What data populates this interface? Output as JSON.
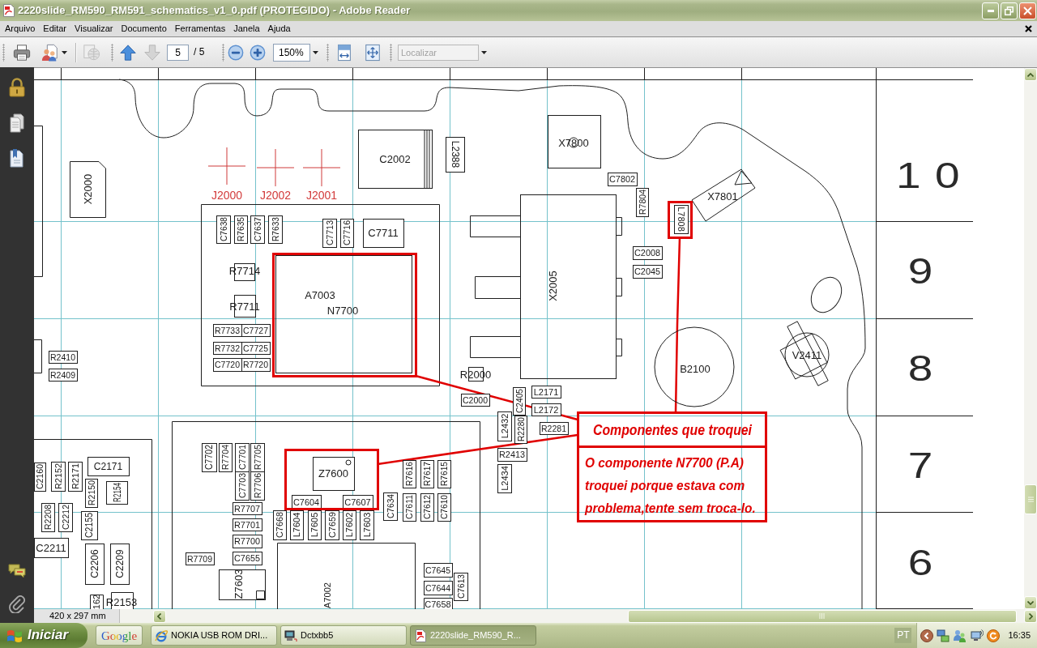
{
  "window": {
    "title": "2220slide_RM590_RM591_schematics_v1_0.pdf (PROTEGIDO) - Adobe Reader"
  },
  "menu": [
    "Arquivo",
    "Editar",
    "Visualizar",
    "Documento",
    "Ferramentas",
    "Janela",
    "Ajuda"
  ],
  "toolbar": {
    "buttons": [
      {
        "kind": "print",
        "disabled": false
      },
      {
        "kind": "collaborate",
        "disabled": false
      },
      {
        "kind": "web",
        "disabled": true
      },
      {
        "kind": "previous_page",
        "disabled": false
      },
      {
        "kind": "next_page",
        "disabled": true
      },
      {
        "kind": "zoom_out",
        "disabled": false
      },
      {
        "kind": "zoom_in",
        "disabled": false
      },
      {
        "kind": "fit_width",
        "disabled": false
      },
      {
        "kind": "fit_page",
        "disabled": false
      }
    ],
    "page": "5",
    "page_total": "/ 5",
    "zoom": "150%",
    "search_placeholder": "Localizar"
  },
  "schematic": {
    "test_points": [
      {
        "label": "J2000"
      },
      {
        "label": "J2002"
      },
      {
        "label": "J2001"
      }
    ],
    "components": [
      {
        "label": "X2000"
      },
      {
        "label": "C2002"
      },
      {
        "label": "L2388"
      },
      {
        "label": "C7638"
      },
      {
        "label": "R7635"
      },
      {
        "label": "C7637"
      },
      {
        "label": "R7633"
      },
      {
        "label": "C7713"
      },
      {
        "label": "C7716"
      },
      {
        "label": "C7711"
      },
      {
        "label": "R7714"
      },
      {
        "label": "R7711"
      },
      {
        "label": "R7733"
      },
      {
        "label": "C7727"
      },
      {
        "label": "R7732"
      },
      {
        "label": "C7725"
      },
      {
        "label": "C7720"
      },
      {
        "label": "R7720"
      },
      {
        "label": "A7003"
      },
      {
        "label": "N7700"
      },
      {
        "label": "R2410"
      },
      {
        "label": "R2409"
      },
      {
        "label": "R2000"
      },
      {
        "label": "C2000"
      },
      {
        "label": "X7800"
      },
      {
        "label": "C7802"
      },
      {
        "label": "R7804"
      },
      {
        "label": "L7808"
      },
      {
        "label": "X7801"
      },
      {
        "label": "X2005"
      },
      {
        "label": "C2008"
      },
      {
        "label": "C2045"
      },
      {
        "label": "B2100"
      },
      {
        "label": "V2411"
      },
      {
        "label": "L2171"
      },
      {
        "label": "L2172"
      },
      {
        "label": "R2281"
      },
      {
        "label": "C2405"
      },
      {
        "label": "R2280"
      },
      {
        "label": "L2432"
      },
      {
        "label": "R2413"
      },
      {
        "label": "L2434"
      },
      {
        "label": "C2160"
      },
      {
        "label": "R2152"
      },
      {
        "label": "R2171"
      },
      {
        "label": "C2171"
      },
      {
        "label": "R2150"
      },
      {
        "label": "R2154"
      },
      {
        "label": "R2208"
      },
      {
        "label": "C2212"
      },
      {
        "label": "C2155"
      },
      {
        "label": "C2211"
      },
      {
        "label": "C2206"
      },
      {
        "label": "C2209"
      },
      {
        "label": "162"
      },
      {
        "label": "R2153"
      },
      {
        "label": "C7702"
      },
      {
        "label": "R7704"
      },
      {
        "label": "C7701"
      },
      {
        "label": "R7705"
      },
      {
        "label": "C7703"
      },
      {
        "label": "R7706"
      },
      {
        "label": "R7707"
      },
      {
        "label": "R7701"
      },
      {
        "label": "R7700"
      },
      {
        "label": "C7655"
      },
      {
        "label": "R7709"
      },
      {
        "label": "Z7603"
      },
      {
        "label": "Z7600"
      },
      {
        "label": "C7604"
      },
      {
        "label": "C7607"
      },
      {
        "label": "C7668"
      },
      {
        "label": "L7604"
      },
      {
        "label": "L7605"
      },
      {
        "label": "C7659"
      },
      {
        "label": "L7602"
      },
      {
        "label": "L7603"
      },
      {
        "label": "C7634"
      },
      {
        "label": "R7616"
      },
      {
        "label": "R7617"
      },
      {
        "label": "R7615"
      },
      {
        "label": "C7611"
      },
      {
        "label": "C7612"
      },
      {
        "label": "C7610"
      },
      {
        "label": "A7002"
      },
      {
        "label": "C7645"
      },
      {
        "label": "C7644"
      },
      {
        "label": "C7658"
      },
      {
        "label": "C7613"
      }
    ],
    "callout": {
      "title": "Componentes que troquei",
      "lines": [
        "O componente N7700 (P.A)",
        "troquei porque estava com",
        "problema,tente sem troca-lo."
      ]
    },
    "zone_numbers": [
      "10",
      "9",
      "8",
      "7",
      "6"
    ]
  },
  "status": {
    "page_size": "420 x 297 mm"
  },
  "taskbar": {
    "start": "Iniciar",
    "quick_launch": "Google",
    "tasks": [
      {
        "label": "NOKIA USB ROM DRI...",
        "selected": false
      },
      {
        "label": "Dctxbb5",
        "selected": false
      },
      {
        "label": "2220slide_RM590_R...",
        "selected": true
      }
    ],
    "language": "PT",
    "clock": "16:35"
  }
}
